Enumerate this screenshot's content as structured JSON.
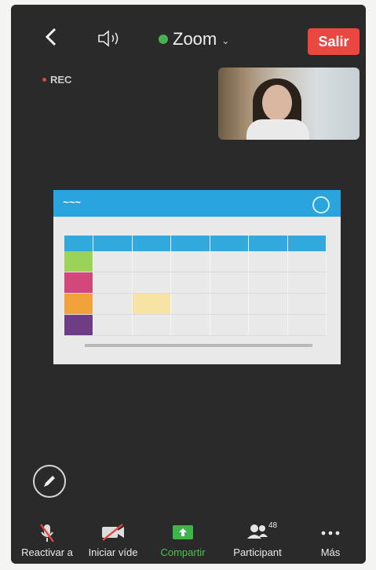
{
  "header": {
    "title": "Zoom",
    "leave_label": "Salir",
    "rec_label": "REC"
  },
  "toolbar": {
    "items": [
      {
        "label": "Reactivar a"
      },
      {
        "label": "Iniciar víde"
      },
      {
        "label": "Compartir"
      },
      {
        "label": "Participant"
      },
      {
        "label": "Más"
      }
    ],
    "participants_count": "48"
  },
  "colors": {
    "leave_button": "#e8483f",
    "share_green": "#49c251",
    "shared_header": "#2aa4dc"
  },
  "icons": {
    "back": "chevron-left-icon",
    "audio": "speaker-icon",
    "secure": "shield-icon",
    "draw": "pencil-icon",
    "mic": "microphone-muted-icon",
    "video": "video-off-icon",
    "share": "share-screen-icon",
    "participants": "participants-icon",
    "more": "more-icon"
  }
}
